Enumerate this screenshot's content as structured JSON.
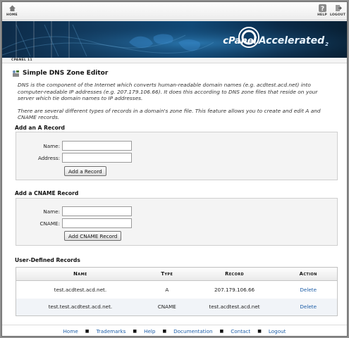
{
  "toolbar": {
    "home_label": "HOME",
    "help_label": "HELP",
    "logout_label": "LOGOUT"
  },
  "banner": {
    "brand_c": "c",
    "brand_panel": "Panel",
    "brand_accelerated": "Accelerated",
    "brand_version": "2"
  },
  "breadcrumb": "CPANEL 11",
  "page": {
    "title": "Simple DNS Zone Editor",
    "desc1": "DNS is the component of the Internet which converts human-readable domain names (e.g. acdtest.acd.net) into computer-readable IP addresses (e.g. 207.179.106.66). It does this according to DNS zone files that reside on your server which tie domain names to IP addresses.",
    "desc2": "There are several different types of records in a domain's zone file. This feature allows you to create and edit A and CNAME records."
  },
  "a_record": {
    "heading": "Add an A Record",
    "name_label": "Name:",
    "name_value": "",
    "address_label": "Address:",
    "address_value": "",
    "button": "Add a Record"
  },
  "cname_record": {
    "heading": "Add a CNAME Record",
    "name_label": "Name:",
    "name_value": "",
    "cname_label": "CNAME:",
    "cname_value": "",
    "button": "Add CNAME Record"
  },
  "records": {
    "heading": "User-Defined Records",
    "columns": [
      "Name",
      "Type",
      "Record",
      "Action"
    ],
    "rows": [
      {
        "name": "test.acdtest.acd.net.",
        "type": "A",
        "record": "207.179.106.66",
        "action": "Delete"
      },
      {
        "name": "test.test.acdtest.acd.net.",
        "type": "CNAME",
        "record": "test.acdtest.acd.net",
        "action": "Delete"
      }
    ]
  },
  "footer": {
    "links": [
      "Home",
      "Trademarks",
      "Help",
      "Documentation",
      "Contact",
      "Logout"
    ]
  },
  "colors": {
    "link": "#1f5fa8",
    "banner_dark": "#0d2b48",
    "box_bg": "#f4f4f4"
  }
}
